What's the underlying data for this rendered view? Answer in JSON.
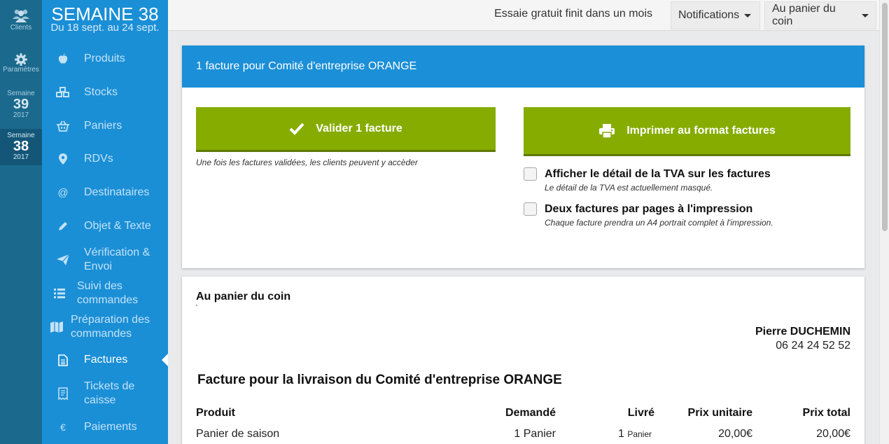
{
  "rail": {
    "clients_label": "Clients",
    "settings_label": "Paramètres",
    "weeks": [
      {
        "label": "Semaine",
        "num": "39",
        "year": "2017"
      },
      {
        "label": "Semaine",
        "num": "38",
        "year": "2017"
      }
    ]
  },
  "sidebar": {
    "week_title": "SEMAINE 38",
    "week_range": "Du 18 sept. au 24 sept.",
    "items": [
      {
        "label": "Produits",
        "icon": "apple-icon"
      },
      {
        "label": "Stocks",
        "icon": "cubes-icon"
      },
      {
        "label": "Paniers",
        "icon": "basket-icon"
      },
      {
        "label": "RDVs",
        "icon": "map-marker-icon"
      },
      {
        "label": "Destinataires",
        "icon": "at-icon"
      },
      {
        "label": "Objet & Texte",
        "icon": "pencil-icon"
      },
      {
        "label": "Vérification & Envoi",
        "icon": "paper-plane-icon"
      },
      {
        "label": "Suivi des commandes",
        "icon": "list-icon"
      },
      {
        "label": "Préparation des commandes",
        "icon": "map-icon"
      },
      {
        "label": "Factures",
        "icon": "file-text-icon",
        "active": true
      },
      {
        "label": "Tickets de caisse",
        "icon": "receipt-icon"
      },
      {
        "label": "Paiements",
        "icon": "euro-icon"
      }
    ]
  },
  "topbar": {
    "trial_text": "Essaie gratuit finit dans un mois",
    "notifications_label": "Notifications",
    "account_label": "Au panier du coin"
  },
  "actions_panel": {
    "header": "1 facture pour Comité d'entreprise ORANGE",
    "validate_label": "Valider 1 facture",
    "validate_hint": "Une fois les factures validées, les clients peuvent y accèder",
    "print_label": "Imprimer au format factures",
    "tva_label": "Afficher le détail de la TVA sur les factures",
    "tva_hint": "Le détail de la TVA est actuellement masqué.",
    "tva_checked": false,
    "two_per_page_label": "Deux factures par pages à l'impression",
    "two_per_page_hint": "Chaque facture prendra un A4 portrait complet à l'impression.",
    "two_per_page_checked": false
  },
  "invoice": {
    "seller_name": "Au panier du coin",
    "seller_extra": "'",
    "client_name": "Pierre DUCHEMIN",
    "client_phone": "06 24 24 52 52",
    "title": "Facture pour la livraison du Comité d'entreprise ORANGE",
    "columns": [
      "Produit",
      "Demandé",
      "Livré",
      "Prix unitaire",
      "Prix total"
    ],
    "rows": [
      {
        "product": "Panier de saison",
        "requested": "1 Panier",
        "delivered_qty": "1",
        "delivered_unit": "Panier",
        "unit_price": "20,00€",
        "total_price": "20,00€"
      }
    ]
  },
  "colors": {
    "rail": "#1b6a8e",
    "sidebar": "#1a8fd6",
    "panel_header": "#1b8fd7",
    "green_button": "#86ac00"
  }
}
